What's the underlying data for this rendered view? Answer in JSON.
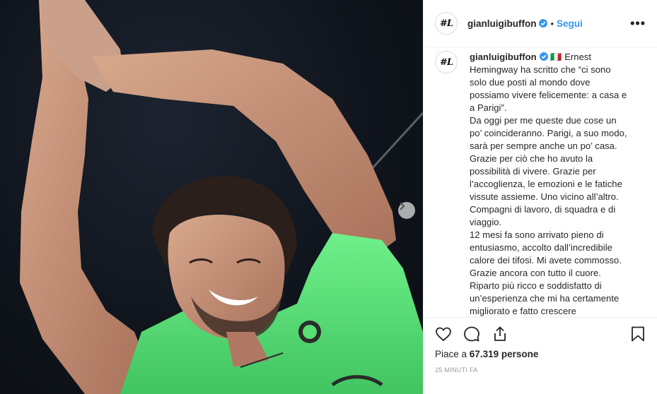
{
  "colors": {
    "accent": "#3897f0",
    "jersey": "#5ee07a",
    "text": "#262626",
    "muted": "#999999"
  },
  "post": {
    "logo_text": "#L",
    "username": "gianluigibuffon",
    "separator": "•",
    "follow_label": "Segui",
    "more_label": "•••",
    "caption_intro": "🇮🇹 Ernest",
    "caption_body": "Hemingway ha scritto che “ci sono solo due posti al mondo dove possiamo vivere felicemente: a casa e a Parigi”.\nDa oggi per me queste due cose un po’ coincideranno. Parigi, a suo modo, sarà per sempre anche un po’ casa.\nGrazie per ciò che ho avuto la possibilità di vivere. Grazie per l’accoglienza, le emozioni e le fatiche vissute assieme. Uno vicino all’altro. Compagni di lavoro, di squadra e di viaggio.\n12 mesi fa sono arrivato pieno di entusiasmo, accolto dall’incredibile calore dei tifosi. Mi avete commosso. Grazie ancora con tutto il cuore.\nRiparto più ricco e soddisfatto di un’esperienza che mi ha certamente migliorato e fatto crescere",
    "likes_prefix": "Piace a",
    "likes_count": "67.319",
    "likes_suffix": "persone",
    "timestamp": "25 MINUTI FA"
  },
  "icons": {
    "verified": "verified-badge-icon",
    "like": "heart-icon",
    "comment": "comment-icon",
    "share": "share-icon",
    "save": "bookmark-icon",
    "next": "chevron-right-icon"
  }
}
